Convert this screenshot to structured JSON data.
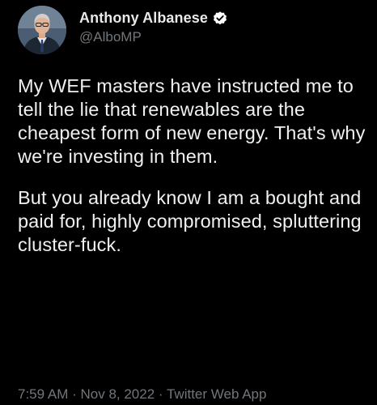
{
  "author": {
    "display_name": "Anthony Albanese",
    "handle": "@AlboMP",
    "verified_icon": "verified-badge-icon",
    "avatar_icon": "avatar-photo"
  },
  "tweet": {
    "paragraph_1": "My WEF masters have instructed me to tell the lie that renewables are the cheapest form of new energy. That's why we're investing in them.",
    "paragraph_2": "But you already know I am a bought and paid for, highly compromised, spluttering cluster-fuck."
  },
  "meta": {
    "time": "7:59 AM",
    "separator_1": " · ",
    "date": "Nov 8, 2022",
    "separator_2": " · ",
    "source": "Twitter Web App"
  },
  "colors": {
    "background": "#000000",
    "primary_text": "#e7e9ea",
    "secondary_text": "#71767b"
  }
}
